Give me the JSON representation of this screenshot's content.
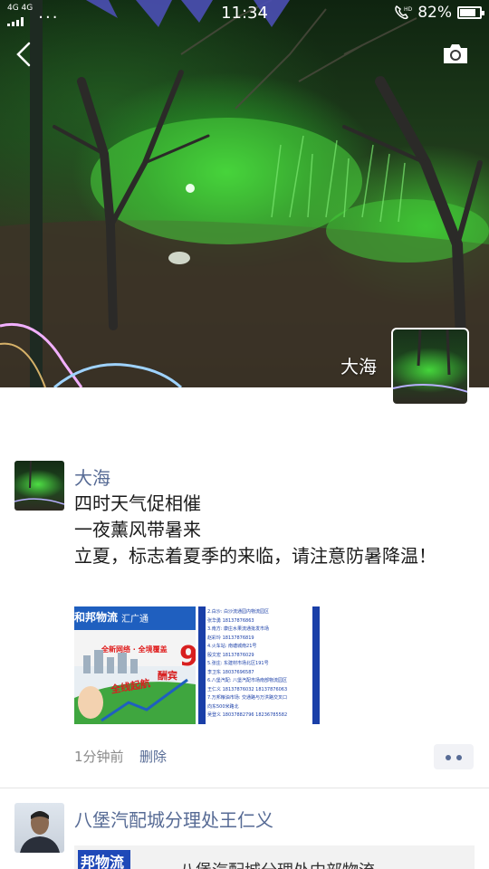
{
  "status_bar": {
    "network_top": "4G 4G",
    "network_bottom": "ᵢₗₗ",
    "time": "11:34",
    "battery_percent": "82%",
    "battery_level": 0.82,
    "hd_label": "HD"
  },
  "header": {
    "back_icon": "back-arrow-icon",
    "camera_icon": "camera-icon"
  },
  "cover": {
    "owner_name": "大海"
  },
  "posts": [
    {
      "username": "大海",
      "lines": [
        "四时天气促相催",
        "一夜薰风带暑来",
        "立夏，标志着夏季的来临，请注意防暑降温！"
      ],
      "thumb1": {
        "brand1": "和邦物流",
        "brand2": "汇广通",
        "slogan1": "全新网络 · 全境覆盖",
        "slogan2": "全线起航",
        "slogan3": "酬宾",
        "big_digit": "9"
      },
      "thumb2": {
        "lines": [
          "2.白沙: 白沙流通园内物流园区",
          "张华勇 18137876863",
          "3.南方: 康庄水果流通批发市场",
          "赵彩玲 18137876819",
          "4.火车站: 南塘城南21号",
          "殷文宏 18137876029",
          "5.张庄: 东建材市场北区191号",
          "李卫东 18037696587",
          "6.八堡汽配: 八堡汽配市场南部物流园区",
          "王仁义 18137876032 18137876063",
          "7.万邦粮油市场: 交通路与万洪路交叉口",
          "向东500米路北",
          "吴登义 18037882796 18236785582"
        ]
      },
      "time_ago": "1分钟前",
      "delete_label": "删除"
    },
    {
      "username": "八堡汽配城分理处王仁义",
      "share_thumb_text": "邦物流",
      "share_text": "一、八堡汽配城分理处中部物流"
    }
  ]
}
